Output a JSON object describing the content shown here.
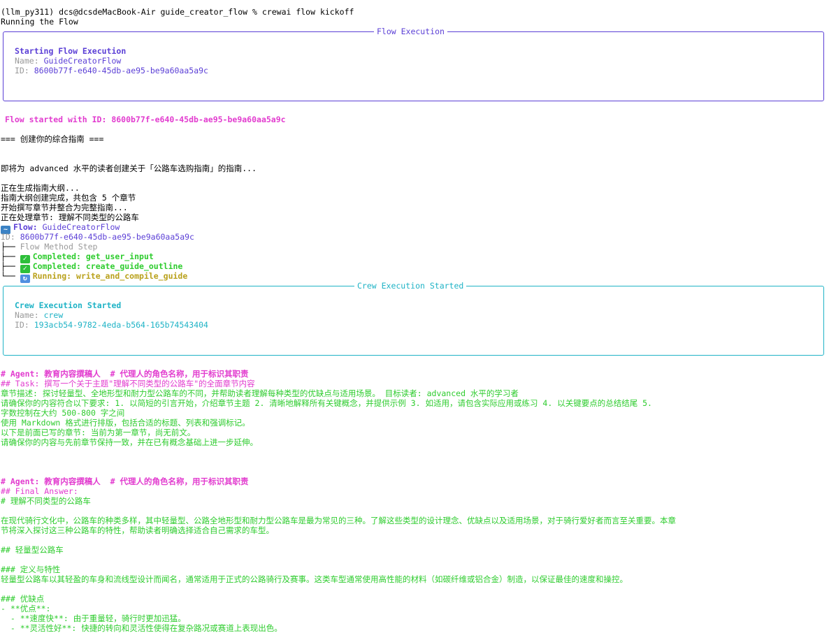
{
  "terminal": {
    "prompt": "(llm_py311) dcs@dcsdeMacBook-Air guide_creator_flow % crewai flow kickoff",
    "running": "Running the Flow"
  },
  "flow_box": {
    "title": "Flow Execution",
    "heading": "Starting Flow Execution",
    "name_label": "Name:",
    "name_value": "GuideCreatorFlow",
    "id_label": "ID:",
    "id_value": "8600b77f-e640-45db-ae95-be9a60aa5a9c"
  },
  "flow_started": "Flow started with ID: 8600b77f-e640-45db-ae95-be9a60aa5a9c",
  "messages": {
    "header": "=== 创建你的综合指南 ===",
    "creating": "即将为 advanced 水平的读者创建关于「公路车选购指南」的指南...",
    "gen_outline": "正在生成指南大纲...",
    "outline_done": "指南大纲创建完成，共包含 5 个章节",
    "start_writing": "开始撰写章节并整合为完整指南...",
    "processing": "正在处理章节: 理解不同类型的公路车"
  },
  "tree": {
    "flow_label": "Flow:",
    "flow_value": "GuideCreatorFlow",
    "id_label": "ID:",
    "id_value": "8600b77f-e640-45db-ae95-be9a60aa5a9c",
    "method_step": "Flow Method Step",
    "completed_1": "Completed: get_user_input",
    "completed_2": "Completed: create_guide_outline",
    "running": "Running: write_and_compile_guide",
    "icons": [
      "wave-icon",
      "checkmark-icon",
      "checkmark-icon",
      "refresh-icon"
    ]
  },
  "crew_box": {
    "title": "Crew Execution Started",
    "heading": "Crew Execution Started",
    "name_label": "Name:",
    "name_value": "crew",
    "id_label": "ID:",
    "id_value": "193acb54-9782-4eda-b564-165b74543404"
  },
  "task_block": {
    "agent": "# Agent: 教育内容撰稿人  # 代理人的角色名称，用于标识其职责",
    "task": "## Task: 撰写一个关于主题\"理解不同类型的公路车\"的全面章节内容",
    "lines": [
      "章节描述: 探讨轻量型、全地形型和耐力型公路车的不同，并帮助读者理解每种类型的优缺点与适用场景。 目标读者: advanced 水平的学习者",
      "请确保你的内容符合以下要求: 1. 以简短的引言开始，介绍章节主题 2. 清晰地解释所有关键概念，并提供示例 3. 如适用，请包含实际应用或练习 4. 以关键要点的总结结尾 5.",
      "字数控制在大约 500-800 字之间",
      "使用 Markdown 格式进行排版，包括合适的标题、列表和强调标记。",
      "以下是前面已写的章节: 当前为第一章节，尚无前文。",
      "请确保你的内容与先前章节保持一致，并在已有概念基础上进一步延伸。"
    ]
  },
  "answer_block": {
    "agent": "# Agent: 教育内容撰稿人  # 代理人的角色名称，用于标识其职责",
    "final_answer": "## Final Answer:",
    "title": "# 理解不同类型的公路车",
    "intro_1": "在现代骑行文化中，公路车的种类多样，其中轻量型、公路全地形型和耐力型公路车是最为常见的三种。了解这些类型的设计理念、优缺点以及适用场景，对于骑行爱好者而言至关重要。本章",
    "intro_2": "节将深入探讨这三种公路车的特性，帮助读者明确选择适合自己需求的车型。",
    "h_light": "## 轻量型公路车",
    "h_def": "### 定义与特性",
    "def_text": "轻量型公路车以其轻盈的车身和流线型设计而闻名，通常适用于正式的公路骑行及赛事。这类车型通常使用高性能的材料（如碳纤维或铝合金）制造，以保证最佳的速度和操控。",
    "h_pros": "### 优缺点",
    "pros": "- **优点**:",
    "pro_1": "  - **速度快**: 由于重量轻，骑行时更加迅猛。",
    "pro_2": "  - **灵活性好**: 快捷的转向和灵活性使得在复杂路况或赛道上表现出色。"
  }
}
